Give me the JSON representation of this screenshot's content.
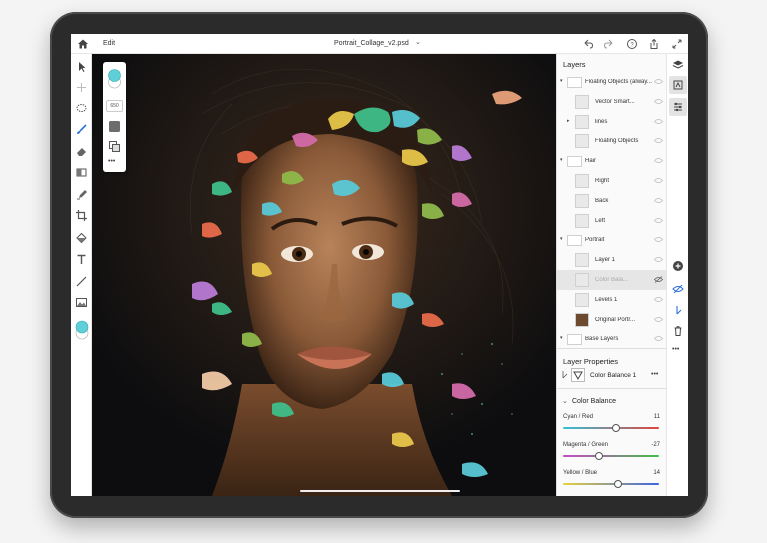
{
  "topbar": {
    "edit_label": "Edit",
    "doc_title": "Portrait_Collage_v2.psd",
    "doc_chevron": "⌄",
    "icons": [
      "home-icon",
      "undo-icon",
      "redo-icon",
      "help-icon",
      "share-icon",
      "fullscreen-icon"
    ]
  },
  "tools": {
    "icons": [
      "move-icon",
      "add-icon",
      "lasso-icon",
      "brush-icon",
      "eraser-icon",
      "gradient-icon",
      "clone-stamp-icon",
      "crop-icon",
      "fill-icon",
      "type-icon",
      "line-icon",
      "image-icon",
      "color-swatch-icon"
    ]
  },
  "floating_palette": {
    "brush_size": "650",
    "more": "•••",
    "accent_color": "#5fd0d8"
  },
  "layers_panel": {
    "title": "Layers",
    "items": [
      {
        "name": "Floating Objects (alway...",
        "indent": 0,
        "group": true
      },
      {
        "name": "Vector Smart...",
        "indent": 1
      },
      {
        "name": "lines",
        "indent": 1
      },
      {
        "name": "Floating Objects",
        "indent": 1
      },
      {
        "name": "Hair",
        "indent": 0,
        "group": true
      },
      {
        "name": "Right",
        "indent": 1
      },
      {
        "name": "Back",
        "indent": 1
      },
      {
        "name": "Left",
        "indent": 1
      },
      {
        "name": "Portrait",
        "indent": 0,
        "group": true
      },
      {
        "name": "Layer 1",
        "indent": 1
      },
      {
        "name": "Color Bala...",
        "indent": 1,
        "selected": true
      },
      {
        "name": "Levels 1",
        "indent": 1
      },
      {
        "name": "Original Portr...",
        "indent": 1
      },
      {
        "name": "Base Layers",
        "indent": 0,
        "group": true
      }
    ]
  },
  "layer_properties": {
    "title": "Layer Properties",
    "layer_name": "Color Balance 1",
    "more": "•••"
  },
  "color_balance": {
    "title": "Color Balance",
    "sliders": [
      {
        "label": "Cyan / Red",
        "value": "11",
        "fraction": 0.55,
        "color_left": "#36c0d6",
        "color_right": "#e0453f"
      },
      {
        "label": "Magenta / Green",
        "value": "-27",
        "fraction": 0.37,
        "color_left": "#c948c5",
        "color_right": "#3fbf4a"
      },
      {
        "label": "Yellow / Blue",
        "value": "14",
        "fraction": 0.57,
        "color_left": "#e8d23b",
        "color_right": "#3d63e0"
      }
    ]
  },
  "right_rail": {
    "icons": [
      "layers-icon",
      "adjustment-layer-icon",
      "properties-icon",
      "add-layer-icon",
      "visibility-icon",
      "fx-icon",
      "delete-icon",
      "more-icon"
    ]
  }
}
